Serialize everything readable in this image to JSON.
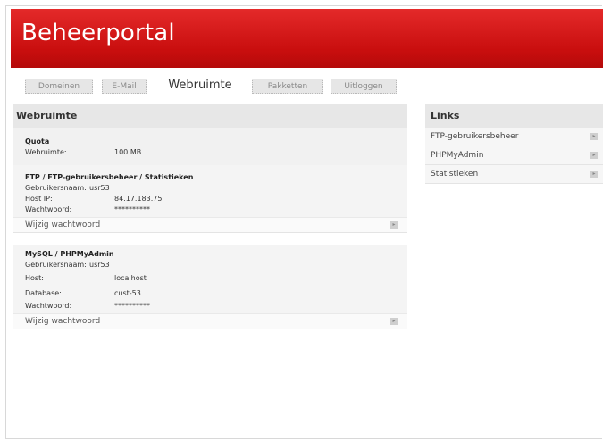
{
  "header": {
    "title": "Beheerportal"
  },
  "tabs": [
    {
      "label": "Domeinen"
    },
    {
      "label": "E-Mail"
    },
    {
      "label": "Webruimte"
    },
    {
      "label": "Pakketten"
    },
    {
      "label": "Uitloggen"
    }
  ],
  "main": {
    "title": "Webruimte",
    "quota": {
      "title": "Quota",
      "label": "Webruimte:",
      "value": "100 MB"
    },
    "ftp": {
      "title": "FTP / FTP-gebruikersbeheer / Statistieken",
      "rows": [
        {
          "label": "Gebruikersnaam:",
          "value": "usr53"
        },
        {
          "label": "Host IP:",
          "value": "84.17.183.75"
        },
        {
          "label": "Wachtwoord:",
          "value": "**********"
        }
      ],
      "action": "Wijzig wachtwoord"
    },
    "mysql": {
      "title": "MySQL / PHPMyAdmin",
      "rows": [
        {
          "label": "Gebruikersnaam:",
          "value": "usr53"
        },
        {
          "label": "Host:",
          "value": "localhost"
        },
        {
          "label": "Database:",
          "value": "cust-53"
        },
        {
          "label": "Wachtwoord:",
          "value": "**********"
        }
      ],
      "action": "Wijzig wachtwoord"
    }
  },
  "links": {
    "title": "Links",
    "items": [
      {
        "label": "FTP-gebruikersbeheer"
      },
      {
        "label": "PHPMyAdmin"
      },
      {
        "label": "Statistieken"
      }
    ]
  },
  "colors": {
    "header_red": "#d11515",
    "panel_gray": "#e7e7e7"
  },
  "icons": {
    "arrow": "arrow-right-icon"
  }
}
